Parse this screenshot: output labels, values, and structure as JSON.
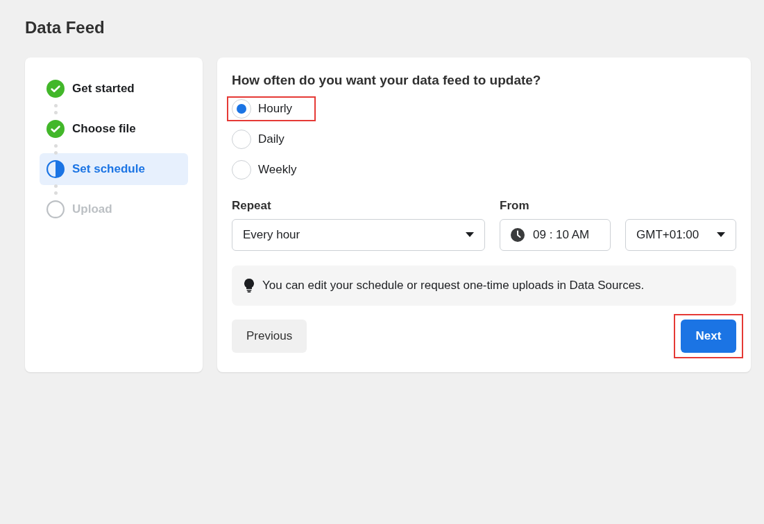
{
  "page_title": "Data Feed",
  "steps": [
    {
      "label": "Get started",
      "kind": "done",
      "selected": false
    },
    {
      "label": "Choose file",
      "kind": "done",
      "selected": false
    },
    {
      "label": "Set schedule",
      "kind": "current",
      "selected": true
    },
    {
      "label": "Upload",
      "kind": "pending",
      "selected": false
    }
  ],
  "question": "How often do you want your data feed to update?",
  "frequency_options": [
    {
      "label": "Hourly",
      "selected": true,
      "highlighted": true
    },
    {
      "label": "Daily",
      "selected": false,
      "highlighted": false
    },
    {
      "label": "Weekly",
      "selected": false,
      "highlighted": false
    }
  ],
  "repeat": {
    "label": "Repeat",
    "value": "Every hour"
  },
  "from": {
    "label": "From",
    "time": "09 : 10 AM",
    "timezone": "GMT+01:00"
  },
  "tip": "You can edit your schedule or request one-time uploads in Data Sources.",
  "previous_button": {
    "label": "Previous"
  },
  "next_button": {
    "label": "Next",
    "highlighted": true
  }
}
